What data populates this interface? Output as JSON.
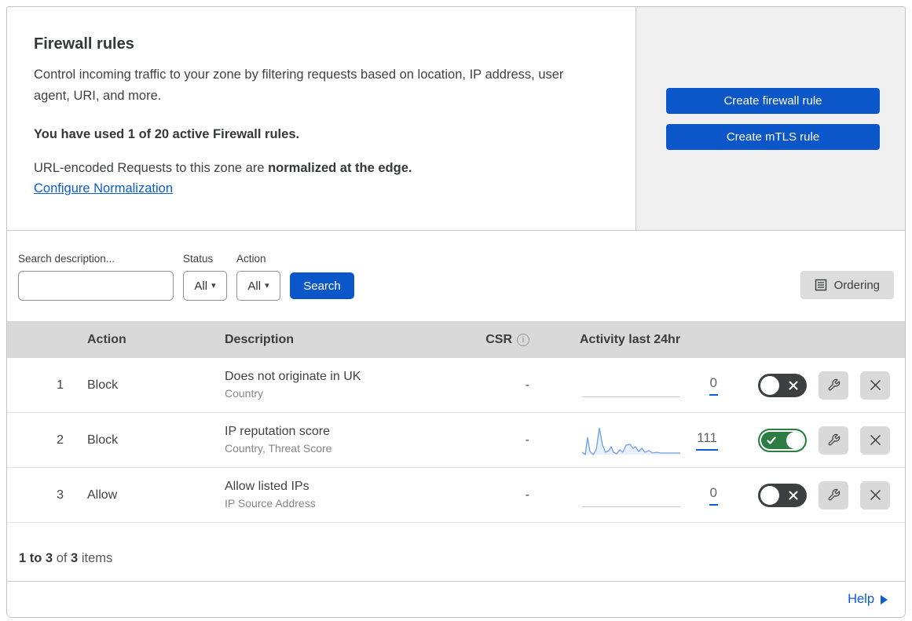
{
  "header": {
    "title": "Firewall rules",
    "description": "Control incoming traffic to your zone by filtering requests based on location, IP address, user agent, URI, and more.",
    "usage_bold": "You have used 1 of 20 active Firewall rules.",
    "normalization_prefix": "URL-encoded Requests to this zone are ",
    "normalization_bold": "normalized at the edge.",
    "normalization_link": "Configure Normalization",
    "buttons": {
      "create_firewall": "Create firewall rule",
      "create_mtls": "Create mTLS rule"
    }
  },
  "filters": {
    "search_label": "Search description...",
    "search_value": "",
    "status_label": "Status",
    "status_value": "All",
    "action_label": "Action",
    "action_value": "All",
    "search_button": "Search",
    "ordering_button": "Ordering"
  },
  "table": {
    "columns": {
      "action": "Action",
      "description": "Description",
      "csr": "CSR",
      "activity": "Activity last 24hr"
    },
    "rows": [
      {
        "priority": "1",
        "action": "Block",
        "description": "Does not originate in UK",
        "fields": "Country",
        "csr": "-",
        "activity_count": "0",
        "enabled": false
      },
      {
        "priority": "2",
        "action": "Block",
        "description": "IP reputation score",
        "fields": "Country, Threat Score",
        "csr": "-",
        "activity_count": "111",
        "enabled": true
      },
      {
        "priority": "3",
        "action": "Allow",
        "description": "Allow listed IPs",
        "fields": "IP Source Address",
        "csr": "-",
        "activity_count": "0",
        "enabled": false
      }
    ]
  },
  "footer": {
    "range_bold": "1 to 3",
    "of_text": " of ",
    "total_bold": "3",
    "items_text": " items",
    "help_label": "Help"
  },
  "colors": {
    "accent_blue": "#0b57c9",
    "link_blue": "#0b5cd6",
    "toggle_on_green": "#2c7c43",
    "toggle_off_charcoal": "#3d4040",
    "sparkline_blue": "#6f9ee8",
    "table_header_gray": "#d9d9d9"
  }
}
